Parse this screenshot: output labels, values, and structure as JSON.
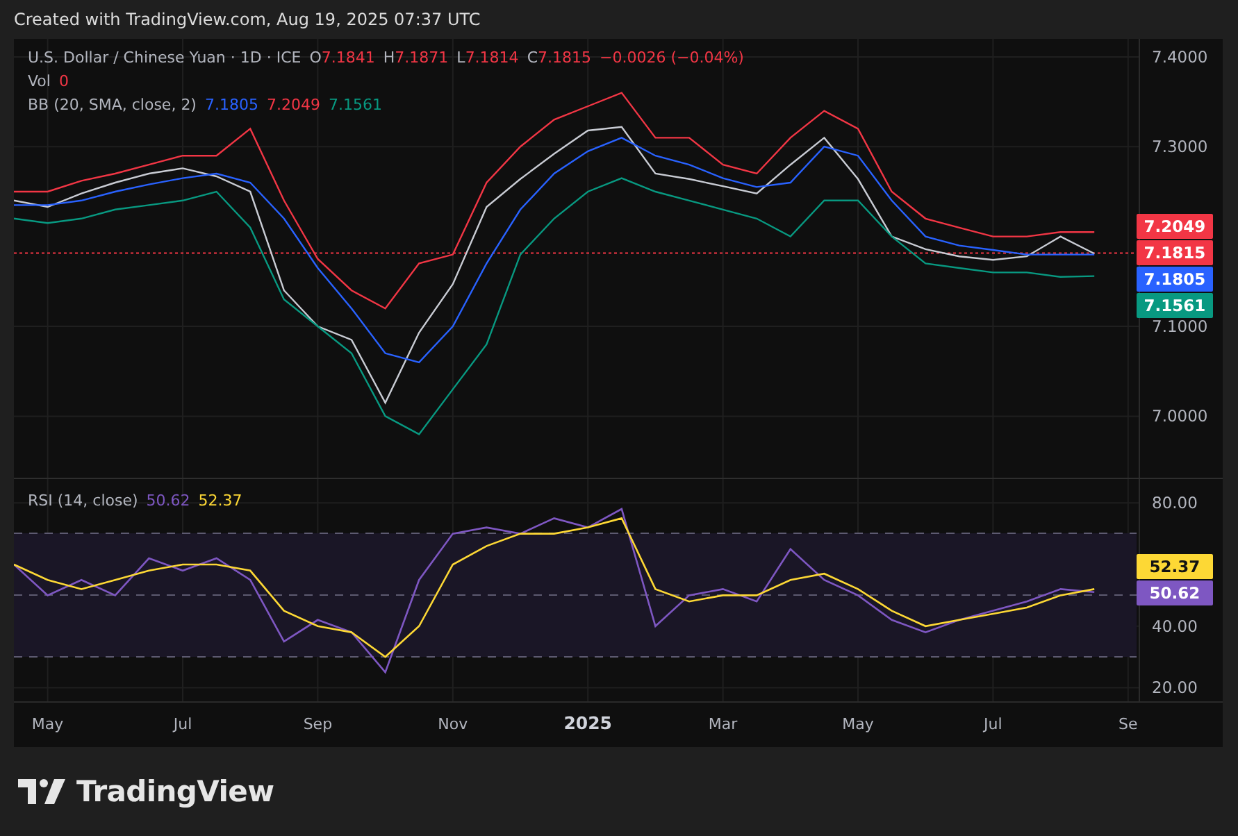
{
  "header": {
    "caption": "Created with TradingView.com, Aug 19, 2025 07:37 UTC"
  },
  "legend": {
    "symbol": "U.S. Dollar / Chinese Yuan · 1D · ICE",
    "ohlc": [
      {
        "label": "O",
        "value": "7.1841"
      },
      {
        "label": "H",
        "value": "7.1871"
      },
      {
        "label": "L",
        "value": "7.1814"
      },
      {
        "label": "C",
        "value": "7.1815"
      }
    ],
    "change": "−0.0026 (−0.04%)",
    "volume_label": "Vol",
    "volume_value": "0",
    "indicator": "BB (20, SMA, close, 2)",
    "indicator_values": [
      {
        "value": "7.1805",
        "color": "#2962ff"
      },
      {
        "value": "7.2049",
        "color": "#f23645"
      },
      {
        "value": "7.1561",
        "color": "#089981"
      }
    ]
  },
  "price_pane": {
    "chart_data": {
      "type": "line",
      "grid": true,
      "series": [
        {
          "color": "#c9ccd4",
          "values": [
            7.24,
            7.233,
            7.248,
            7.26,
            7.27,
            7.276,
            7.267,
            7.25,
            7.14,
            7.1,
            7.085,
            7.015,
            7.093,
            7.147,
            7.233,
            7.264,
            7.292,
            7.318,
            7.322,
            7.27,
            7.264,
            7.256,
            7.248,
            7.28,
            7.31,
            7.264,
            7.2,
            7.186,
            7.178,
            7.174,
            7.178,
            7.2,
            7.181
          ]
        },
        {
          "color": "#f23645",
          "values": [
            7.25,
            7.25,
            7.262,
            7.27,
            7.28,
            7.29,
            7.29,
            7.32,
            7.24,
            7.175,
            7.14,
            7.12,
            7.17,
            7.18,
            7.26,
            7.3,
            7.33,
            7.345,
            7.36,
            7.31,
            7.31,
            7.28,
            7.27,
            7.31,
            7.34,
            7.32,
            7.25,
            7.22,
            7.21,
            7.2,
            7.2,
            7.205,
            7.205
          ]
        },
        {
          "color": "#2962ff",
          "values": [
            7.235,
            7.235,
            7.24,
            7.25,
            7.258,
            7.265,
            7.27,
            7.26,
            7.22,
            7.165,
            7.12,
            7.07,
            7.06,
            7.1,
            7.17,
            7.23,
            7.27,
            7.295,
            7.31,
            7.29,
            7.28,
            7.265,
            7.255,
            7.26,
            7.3,
            7.29,
            7.24,
            7.2,
            7.19,
            7.185,
            7.18,
            7.18,
            7.18
          ]
        },
        {
          "color": "#089981",
          "values": [
            7.22,
            7.215,
            7.22,
            7.23,
            7.235,
            7.24,
            7.25,
            7.21,
            7.13,
            7.1,
            7.07,
            7.0,
            6.98,
            7.03,
            7.08,
            7.18,
            7.22,
            7.25,
            7.265,
            7.25,
            7.24,
            7.23,
            7.22,
            7.2,
            7.24,
            7.24,
            7.2,
            7.17,
            7.165,
            7.16,
            7.16,
            7.155,
            7.156
          ]
        }
      ],
      "ylim": [
        6.93,
        7.42
      ],
      "yticks": [
        {
          "value": 7.0,
          "label": "7.0000"
        },
        {
          "value": 7.1,
          "label": "7.1000"
        },
        {
          "value": 7.3,
          "label": "7.3000"
        },
        {
          "value": 7.4,
          "label": "7.4000"
        }
      ],
      "ref_lines": [
        {
          "axis": "y",
          "value": 7.1815,
          "label": "7.1815",
          "color": "#f23645"
        }
      ]
    },
    "tags": [
      {
        "value": "7.2049",
        "color": "#f23645"
      },
      {
        "value": "7.1805",
        "color": "#2962ff"
      },
      {
        "value": "7.1561",
        "color": "#089981"
      }
    ]
  },
  "rsi_pane": {
    "legend": "RSI (14, close)",
    "values": [
      {
        "value": "50.62",
        "color": "#7e57c2"
      },
      {
        "value": "52.37",
        "color": "#fdd835"
      }
    ],
    "chart_data": {
      "type": "line",
      "grid": true,
      "categories": [
        null,
        "May",
        null,
        null,
        null,
        "Jul",
        null,
        null,
        null,
        "Sep",
        null,
        null,
        null,
        "Nov",
        null,
        null,
        null,
        "2025",
        null,
        null,
        null,
        "Mar",
        null,
        null,
        null,
        "May",
        null,
        null,
        null,
        "Jul",
        null,
        null,
        null,
        "Se"
      ],
      "series": [
        {
          "color": "#7e57c2",
          "values": [
            60,
            50,
            55,
            50,
            62,
            58,
            62,
            55,
            35,
            42,
            38,
            25,
            55,
            70,
            72,
            70,
            75,
            72,
            78,
            40,
            50,
            52,
            48,
            65,
            55,
            50,
            42,
            38,
            42,
            45,
            48,
            52,
            51,
            null
          ]
        },
        {
          "color": "#fdd835",
          "values": [
            60,
            55,
            52,
            55,
            58,
            60,
            60,
            58,
            45,
            40,
            38,
            30,
            40,
            60,
            66,
            70,
            70,
            72,
            75,
            52,
            48,
            50,
            50,
            55,
            57,
            52,
            45,
            40,
            42,
            44,
            46,
            50,
            52,
            null
          ]
        }
      ],
      "ylim": [
        15.6,
        87.7
      ],
      "yticks": [
        {
          "value": 20,
          "label": "20.00"
        },
        {
          "value": 40,
          "label": "40.00"
        },
        {
          "value": 80,
          "label": "80.00"
        }
      ]
    },
    "tags": [
      {
        "value": "52.37",
        "color": "#fdd835"
      },
      {
        "value": "50.62",
        "color": "#7e57c2"
      }
    ]
  },
  "footer": {
    "brand": "TradingView"
  }
}
